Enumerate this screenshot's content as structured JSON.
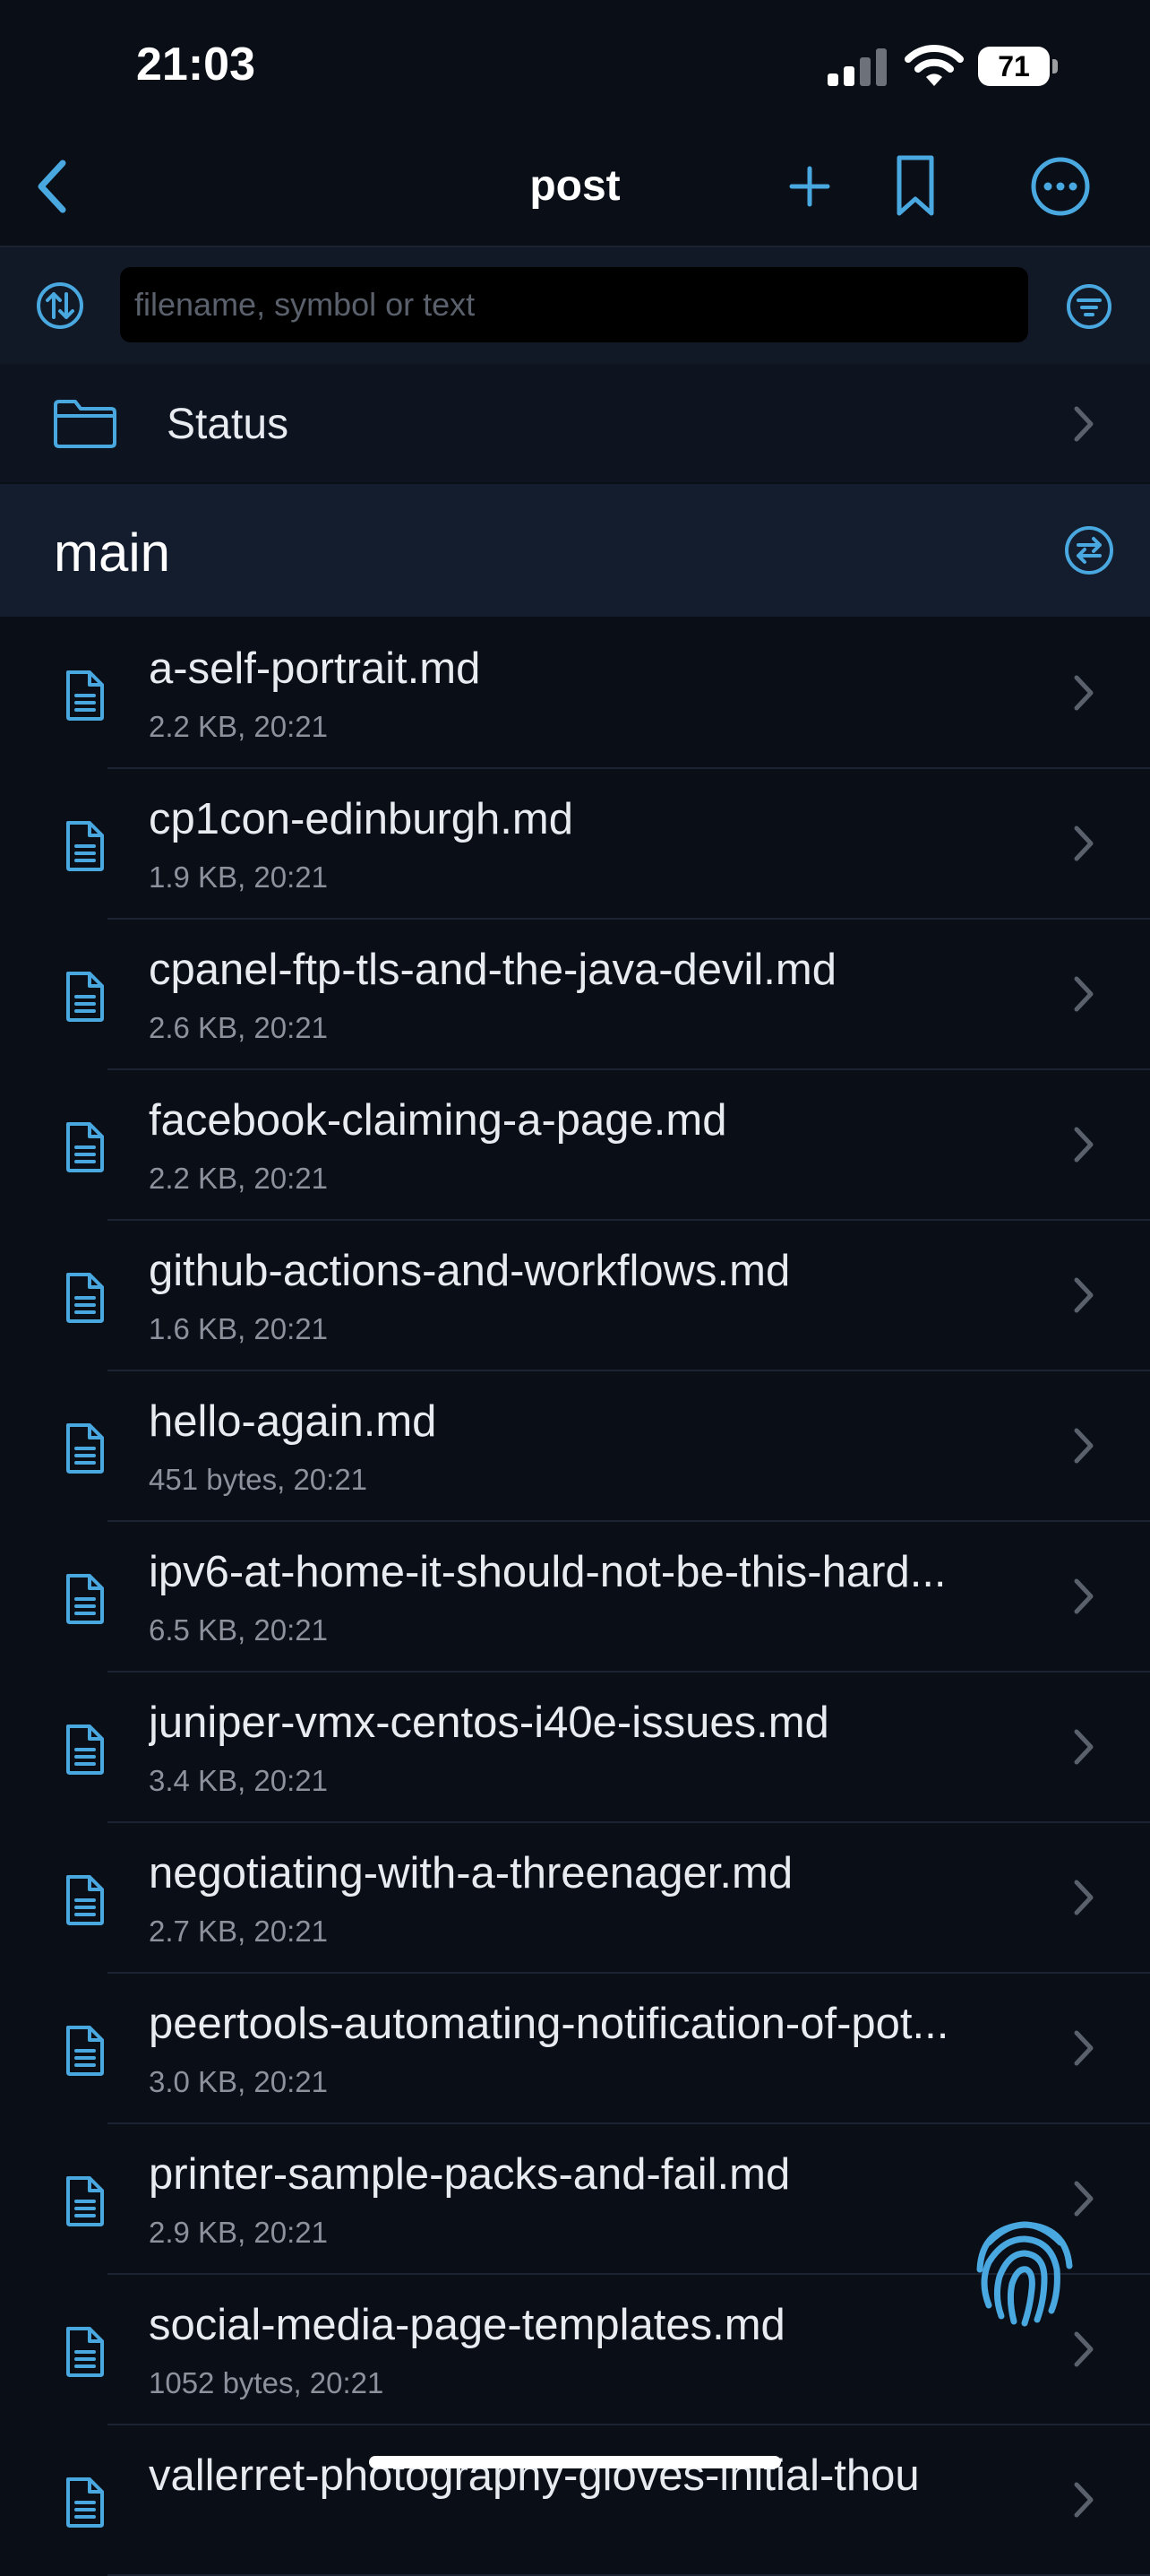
{
  "status_bar": {
    "time": "21:03",
    "battery": "71"
  },
  "nav": {
    "title": "post"
  },
  "search": {
    "placeholder": "filename, symbol or text"
  },
  "status_row": {
    "label": "Status"
  },
  "branch": {
    "label": "main"
  },
  "files": [
    {
      "name": "a-self-portrait.md",
      "meta": "2.2 KB, 20:21"
    },
    {
      "name": "cp1con-edinburgh.md",
      "meta": "1.9 KB, 20:21"
    },
    {
      "name": "cpanel-ftp-tls-and-the-java-devil.md",
      "meta": "2.6 KB, 20:21"
    },
    {
      "name": "facebook-claiming-a-page.md",
      "meta": "2.2 KB, 20:21"
    },
    {
      "name": "github-actions-and-workflows.md",
      "meta": "1.6 KB, 20:21"
    },
    {
      "name": "hello-again.md",
      "meta": "451 bytes, 20:21"
    },
    {
      "name": "ipv6-at-home-it-should-not-be-this-hard...",
      "meta": "6.5 KB, 20:21"
    },
    {
      "name": "juniper-vmx-centos-i40e-issues.md",
      "meta": "3.4 KB, 20:21"
    },
    {
      "name": "negotiating-with-a-threenager.md",
      "meta": "2.7 KB, 20:21"
    },
    {
      "name": "peertools-automating-notification-of-pot...",
      "meta": "3.0 KB, 20:21"
    },
    {
      "name": "printer-sample-packs-and-fail.md",
      "meta": "2.9 KB, 20:21"
    },
    {
      "name": "social-media-page-templates.md",
      "meta": "1052 bytes, 20:21"
    },
    {
      "name": "vallerret-photography-gloves-initial-thou",
      "meta": ""
    }
  ],
  "colors": {
    "accent": "#4aa8e0",
    "background": "#0a0e17",
    "header": "#131d2d"
  },
  "icons": {
    "back": "chevron-left-icon",
    "add": "plus-icon",
    "bookmark": "bookmark-icon",
    "more": "ellipsis-circle-icon",
    "sort": "sort-arrows-icon",
    "filter": "filter-icon",
    "folder": "folder-icon",
    "branch_switch": "branch-switch-icon",
    "file": "document-icon",
    "fingerprint": "fingerprint-icon"
  }
}
